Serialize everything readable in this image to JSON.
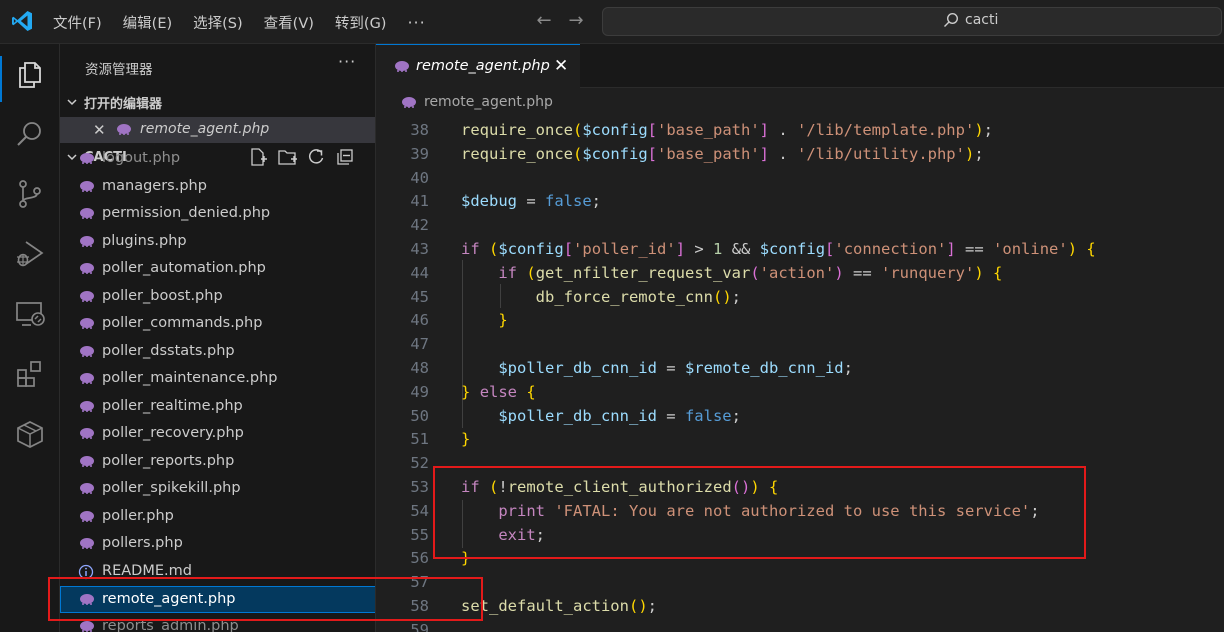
{
  "menu": [
    "文件(F)",
    "编辑(E)",
    "选择(S)",
    "查看(V)",
    "转到(G)"
  ],
  "menu_more": "···",
  "search": {
    "text": "cacti"
  },
  "sidebar": {
    "title": "资源管理器",
    "more": "···",
    "open_editors_header": "打开的编辑器",
    "open_editor_file": "remote_agent.php",
    "project_header": "CACTI",
    "files": [
      {
        "name": "logout.php",
        "state": "partial"
      },
      {
        "name": "managers.php"
      },
      {
        "name": "permission_denied.php"
      },
      {
        "name": "plugins.php"
      },
      {
        "name": "poller_automation.php"
      },
      {
        "name": "poller_boost.php"
      },
      {
        "name": "poller_commands.php"
      },
      {
        "name": "poller_dsstats.php"
      },
      {
        "name": "poller_maintenance.php"
      },
      {
        "name": "poller_realtime.php"
      },
      {
        "name": "poller_recovery.php"
      },
      {
        "name": "poller_reports.php"
      },
      {
        "name": "poller_spikekill.php"
      },
      {
        "name": "poller.php"
      },
      {
        "name": "pollers.php"
      },
      {
        "name": "README.md",
        "state": "info"
      },
      {
        "name": "remote_agent.php",
        "state": "selected"
      },
      {
        "name": "reports_admin.php",
        "state": "partial"
      }
    ]
  },
  "tab": {
    "label": "remote_agent.php",
    "close": "✕"
  },
  "breadcrumb": {
    "label": "remote_agent.php"
  },
  "code": {
    "line_numbers": [
      "38",
      "39",
      "40",
      "41",
      "42",
      "43",
      "44",
      "45",
      "46",
      "47",
      "48",
      "49",
      "50",
      "51",
      "52",
      "53",
      "54",
      "55",
      "56",
      "57",
      "58",
      "59"
    ],
    "lines": [
      "require_once($config['base_path'] . '/lib/template.php');",
      "require_once($config['base_path'] . '/lib/utility.php');",
      "",
      "$debug = false;",
      "",
      "if ($config['poller_id'] > 1 && $config['connection'] == 'online') {",
      "    if (get_nfilter_request_var('action') == 'runquery') {",
      "        db_force_remote_cnn();",
      "    }",
      "",
      "    $poller_db_cnn_id = $remote_db_cnn_id;",
      "} else {",
      "    $poller_db_cnn_id = false;",
      "}",
      "",
      "if (!remote_client_authorized()) {",
      "    print 'FATAL: You are not authorized to use this service';",
      "    exit;",
      "}",
      "",
      "set_default_action();",
      ""
    ]
  },
  "colors": {
    "accent": "#0078d4",
    "highlight_box": "#e31a1a",
    "php_icon": "#a074c4"
  }
}
